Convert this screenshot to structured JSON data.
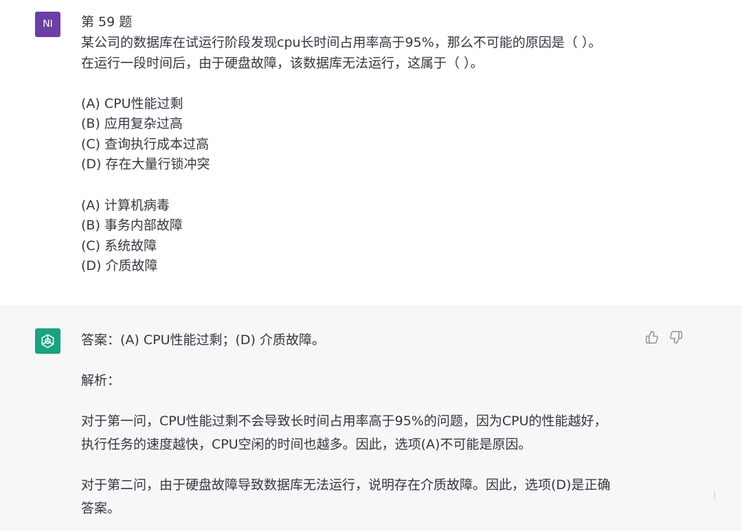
{
  "user": {
    "avatar_initials": "NI",
    "avatar_color": "#6b3fa5",
    "title": "第 59 题",
    "q1": "某公司的数据库在试运行阶段发现cpu长时间占用率高于95%，那么不可能的原因是（ ）。",
    "q2": "在运行一段时间后，由于硬盘故障，该数据库无法运行，这属于（ ）。",
    "options1": [
      "(A) CPU性能过剩",
      "(B) 应用复杂过高",
      "(C) 查询执行成本过高",
      "(D) 存在大量行锁冲突"
    ],
    "options2": [
      "(A) 计算机病毒",
      "(B) 事务内部故障",
      "(C) 系统故障",
      "(D) 介质故障"
    ]
  },
  "assistant": {
    "avatar_icon": "openai-logo-icon",
    "avatar_color": "#19a37f",
    "answer": "答案：(A) CPU性能过剩；(D) 介质故障。",
    "analysis_label": "解析：",
    "para1_line1": "对于第一问，CPU性能过剩不会导致长时间占用率高于95%的问题，因为CPU的性能越好，",
    "para1_line2": "执行任务的速度越快，CPU空闲的时间也越多。因此，选项(A)不可能是原因。",
    "para2_line1": "对于第二问，由于硬盘故障导致数据库无法运行，说明存在介质故障。因此，选项(D)是正确",
    "para2_line2": "答案。",
    "thumbs_up_icon": "thumbs-up-icon",
    "thumbs_down_icon": "thumbs-down-icon"
  }
}
